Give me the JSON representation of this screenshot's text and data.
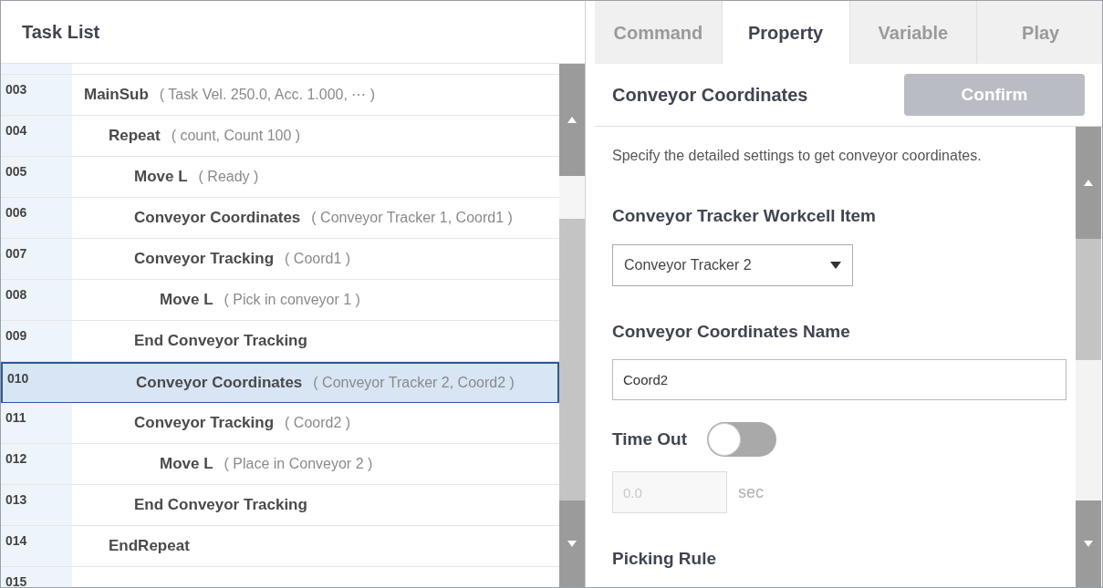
{
  "task_list": {
    "title": "Task List",
    "rows": [
      {
        "number": "003",
        "command": "MainSub",
        "params": "( Task Vel. 250.0, Acc. 1.000, ⋯ )",
        "selected": false,
        "children": [
          {
            "number": "004",
            "command": "Repeat",
            "params": "( count, Count 100 )",
            "selected": false,
            "children": [
              {
                "number": "005",
                "command": "Move L",
                "params": "( Ready )",
                "selected": false
              },
              {
                "number": "006",
                "command": "Conveyor Coordinates",
                "params": "( Conveyor Tracker 1, Coord1 )",
                "selected": false
              },
              {
                "number": "007",
                "command": "Conveyor Tracking",
                "params": "( Coord1 )",
                "selected": false,
                "children": [
                  {
                    "number": "008",
                    "command": "Move L",
                    "params": "( Pick in conveyor 1 )",
                    "selected": false
                  }
                ]
              },
              {
                "number": "009",
                "command": "End Conveyor Tracking",
                "selected": false
              },
              {
                "number": "010",
                "command": "Conveyor Coordinates",
                "params": "( Conveyor Tracker 2, Coord2 )",
                "selected": true
              },
              {
                "number": "011",
                "command": "Conveyor Tracking",
                "params": "( Coord2 )",
                "selected": false,
                "children": [
                  {
                    "number": "012",
                    "command": "Move L",
                    "params": "( Place in Conveyor 2 )",
                    "selected": false
                  }
                ]
              },
              {
                "number": "013",
                "command": "End Conveyor Tracking",
                "selected": false
              }
            ]
          },
          {
            "number": "014",
            "command": "EndRepeat",
            "selected": false
          }
        ]
      },
      {
        "number": "015",
        "selected": false
      }
    ]
  },
  "tabs": [
    {
      "label": "Command",
      "selected": false
    },
    {
      "label": "Property",
      "selected": true
    },
    {
      "label": "Variable",
      "selected": false
    },
    {
      "label": "Play",
      "selected": false
    }
  ],
  "property": {
    "title": "Conveyor Coordinates",
    "confirm": {
      "label": "Confirm",
      "disabled": true
    },
    "description": "Specify the detailed settings to get conveyor coordinates.",
    "tracker_label": "Conveyor Tracker Workcell Item",
    "tracker_value": "Conveyor Tracker 2",
    "name_label": "Conveyor Coordinates Name",
    "name_value": "Coord2",
    "timeout_label": "Time Out",
    "timeout_on": false,
    "timeout_placeholder": "0.0",
    "timeout_unit": "sec",
    "picking_label": "Picking Rule"
  }
}
